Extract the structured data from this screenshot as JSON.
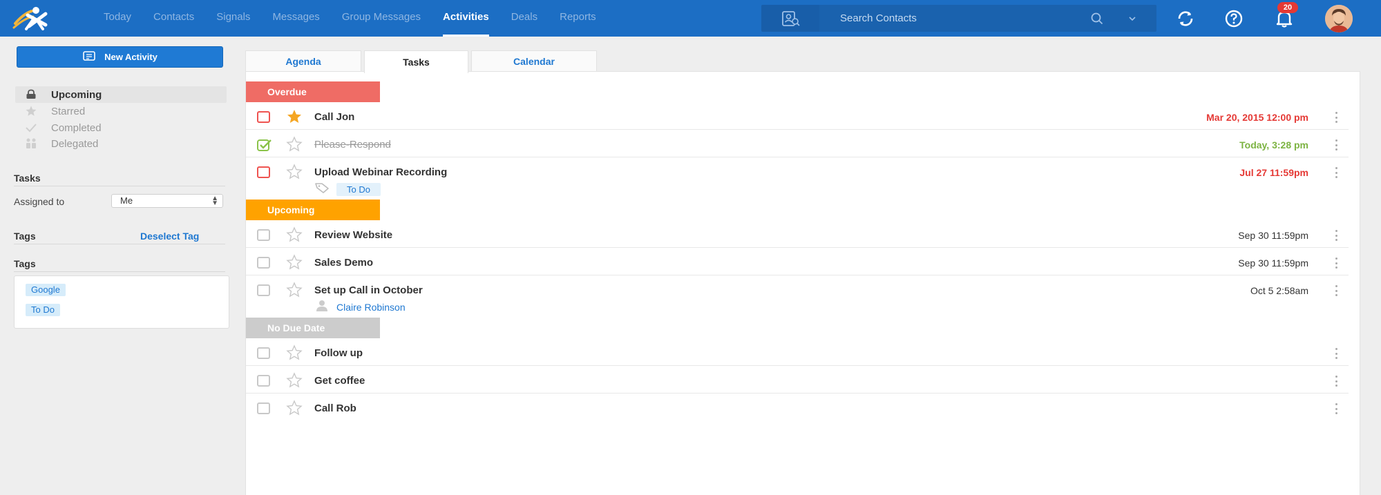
{
  "colors": {
    "topbar": "#1c6ec4",
    "accent": "#1f78d1",
    "overdue": "#ef6c65",
    "upcoming": "#ffa200",
    "no_due_date": "#cccccc",
    "overdue_text": "#e53935",
    "today_text": "#7cb342"
  },
  "header": {
    "nav": [
      "Today",
      "Contacts",
      "Signals",
      "Messages",
      "Group Messages",
      "Activities",
      "Deals",
      "Reports"
    ],
    "active_nav": "Activities",
    "search_placeholder": "Search Contacts",
    "notifications_count": "20",
    "icons": [
      "contact-card-icon",
      "search-icon",
      "chevron-down-icon",
      "sync-icon",
      "help-icon",
      "bell-icon"
    ]
  },
  "sidebar": {
    "new_activity_label": "New Activity",
    "filters": [
      {
        "label": "Upcoming",
        "icon": "lock-icon",
        "active": true
      },
      {
        "label": "Starred",
        "icon": "star-icon",
        "active": false
      },
      {
        "label": "Completed",
        "icon": "check-icon",
        "active": false
      },
      {
        "label": "Delegated",
        "icon": "people-icon",
        "active": false
      }
    ],
    "tasks_heading": "Tasks",
    "assigned_label": "Assigned to",
    "assigned_value": "Me",
    "tags_heading": "Tags",
    "deselect_label": "Deselect Tag",
    "tags_list_heading": "Tags",
    "tags": [
      "Google",
      "To Do"
    ]
  },
  "tabs": [
    {
      "label": "Agenda",
      "active": false
    },
    {
      "label": "Tasks",
      "active": true
    },
    {
      "label": "Calendar",
      "active": false
    }
  ],
  "groups": [
    {
      "label": "Overdue",
      "tasks": [
        {
          "title": "Call Jon",
          "due": "Mar 20, 2015 12:00 pm",
          "due_style": "red",
          "checkbox": "red",
          "starred": true
        },
        {
          "title": "Please-Respond",
          "due": "Today, 3:28 pm",
          "due_style": "green",
          "checkbox": "done",
          "starred": false,
          "completed": true
        },
        {
          "title": "Upload Webinar Recording",
          "due": "Jul 27 11:59pm",
          "due_style": "red",
          "checkbox": "red",
          "starred": false,
          "tag": "To Do"
        }
      ]
    },
    {
      "label": "Upcoming",
      "tasks": [
        {
          "title": "Review Website",
          "due": "Sep 30 11:59pm",
          "due_style": "normal",
          "checkbox": "normal",
          "starred": false
        },
        {
          "title": "Sales Demo",
          "due": "Sep 30 11:59pm",
          "due_style": "normal",
          "checkbox": "normal",
          "starred": false
        },
        {
          "title": "Set up Call in October",
          "due": "Oct 5 2:58am",
          "due_style": "normal",
          "checkbox": "normal",
          "starred": false,
          "contact": "Claire Robinson"
        }
      ]
    },
    {
      "label": "No Due Date",
      "tasks": [
        {
          "title": "Follow up",
          "due": "",
          "due_style": "normal",
          "checkbox": "normal",
          "starred": false
        },
        {
          "title": "Get coffee",
          "due": "",
          "due_style": "normal",
          "checkbox": "normal",
          "starred": false
        },
        {
          "title": "Call Rob",
          "due": "",
          "due_style": "normal",
          "checkbox": "normal",
          "starred": false
        }
      ]
    }
  ]
}
